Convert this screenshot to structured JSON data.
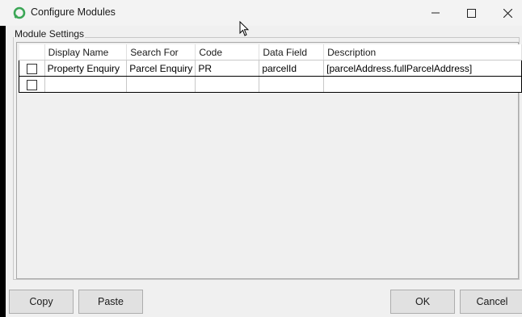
{
  "window": {
    "title": "Configure Modules",
    "controls": [
      "minimize-icon",
      "maximize-icon",
      "close-icon"
    ]
  },
  "group": {
    "label": "Module Settings"
  },
  "grid": {
    "columns": [
      "Display Name",
      "Search For",
      "Code",
      "Data Field",
      "Description"
    ],
    "rows": [
      {
        "checked": false,
        "display_name": "Property Enquiry",
        "search_for": "Parcel Enquiry",
        "code": "PR",
        "data_field": "parcelId",
        "description": "[parcelAddress.fullParcelAddress]"
      },
      {
        "checked": false,
        "display_name": "",
        "search_for": "",
        "code": "",
        "data_field": "",
        "description": ""
      }
    ]
  },
  "buttons": {
    "copy": "Copy",
    "paste": "Paste",
    "ok": "OK",
    "cancel": "Cancel"
  },
  "colors": {
    "accent_icon": "#3aa655"
  }
}
